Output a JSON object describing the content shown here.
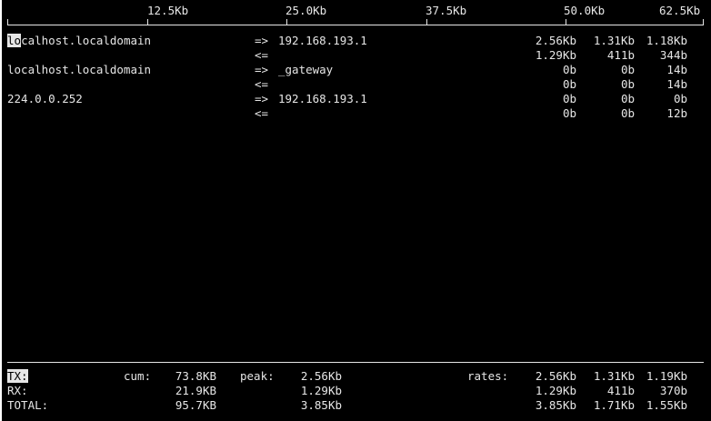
{
  "scale": [
    "12.5Kb",
    "25.0Kb",
    "37.5Kb",
    "50.0Kb",
    "62.5Kb"
  ],
  "hosts": [
    {
      "host": "localhost.localdomain",
      "out_arrow": "=>",
      "in_arrow": "<=",
      "peer": "192.168.193.1",
      "sent": [
        "2.56Kb",
        "1.31Kb",
        "1.18Kb"
      ],
      "recv": [
        "1.29Kb",
        "411b",
        "344b"
      ]
    },
    {
      "host": "localhost.localdomain",
      "out_arrow": "=>",
      "in_arrow": "<=",
      "peer": "_gateway",
      "sent": [
        "0b",
        "0b",
        "14b"
      ],
      "recv": [
        "0b",
        "0b",
        "14b"
      ]
    },
    {
      "host": "224.0.0.252",
      "out_arrow": "=>",
      "in_arrow": "<=",
      "peer": "192.168.193.1",
      "sent": [
        "0b",
        "0b",
        "0b"
      ],
      "recv": [
        "0b",
        "0b",
        "12b"
      ]
    }
  ],
  "totals": {
    "tx_label": "TX:",
    "rx_label": "RX:",
    "total_label": "TOTAL:",
    "cum_label": "cum:",
    "peak_label": "peak:",
    "rates_label": "rates:",
    "tx_cum": "73.8KB",
    "rx_cum": "21.9KB",
    "total_cum": "95.7KB",
    "tx_peak": "2.56Kb",
    "rx_peak": "1.29Kb",
    "total_peak": "3.85Kb",
    "tx_rates": [
      "2.56Kb",
      "1.31Kb",
      "1.19Kb"
    ],
    "rx_rates": [
      "1.29Kb",
      "411b",
      "370b"
    ],
    "total_rates": [
      "3.85Kb",
      "1.71Kb",
      "1.55Kb"
    ]
  }
}
